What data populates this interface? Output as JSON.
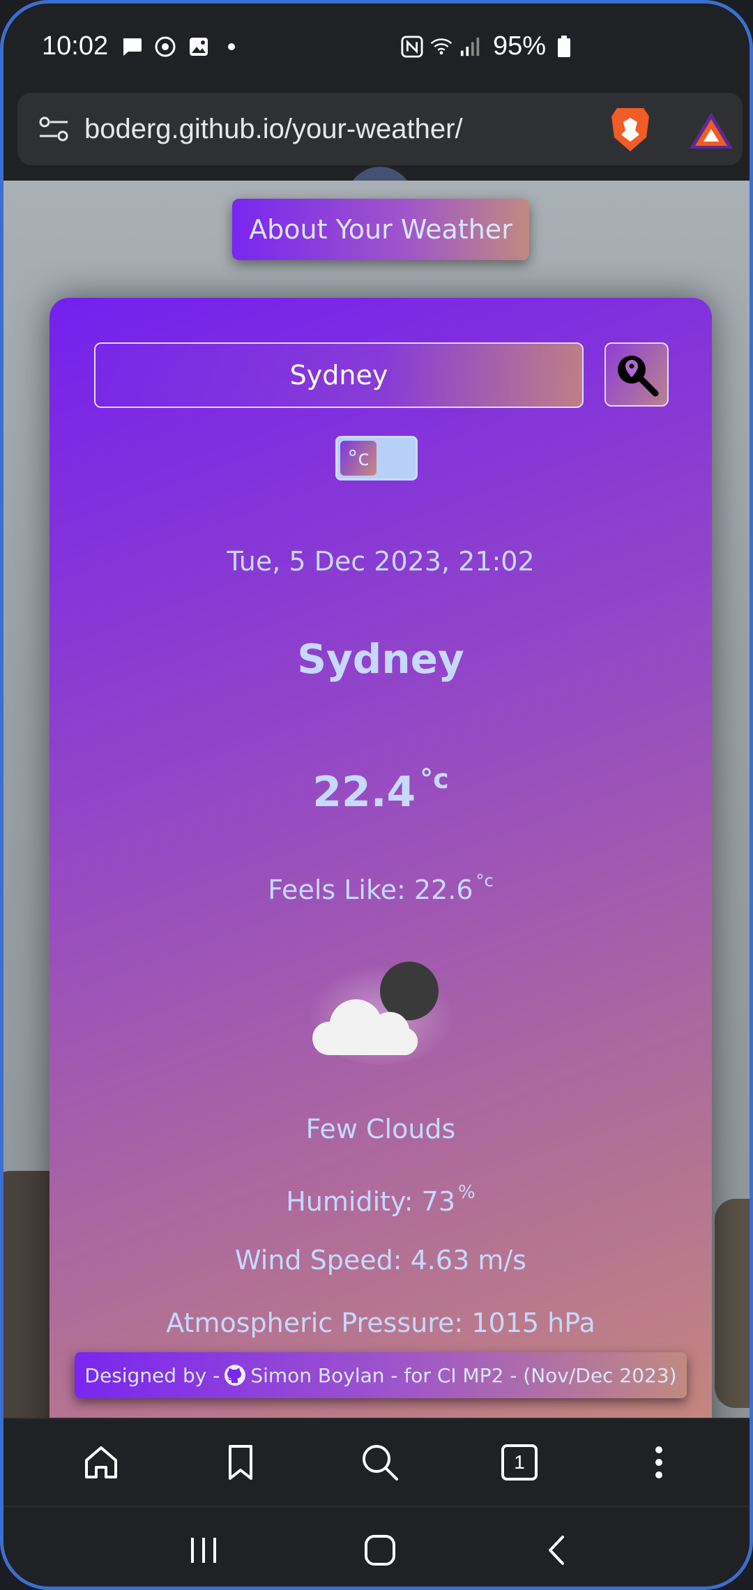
{
  "status_bar": {
    "time": "10:02",
    "battery": "95%"
  },
  "browser": {
    "url": "boderg.github.io/your-weather/",
    "tab_count": "1"
  },
  "page": {
    "about_button": "About Your Weather",
    "search_value": "Sydney",
    "unit_label": "°c",
    "date": "Tue, 5 Dec 2023, 21:02",
    "city": "Sydney",
    "temperature": "22.4",
    "temperature_unit": "°c",
    "feels_like": "Feels Like: 22.6",
    "feels_like_unit": "°c",
    "description": "Few Clouds",
    "humidity": "Humidity: 73",
    "humidity_unit": "%",
    "wind": "Wind Speed: 4.63 m/s",
    "pressure": "Atmospheric Pressure: 1015 hPa",
    "footer": {
      "prefix": "Designed by -",
      "suffix": "Simon Boylan - for CI MP2 - (Nov/Dec 2023)"
    }
  },
  "colors": {
    "accent_purple": "#7a26f0",
    "accent_peach": "#c08a80",
    "text_light_blue": "#c6d9ff"
  }
}
